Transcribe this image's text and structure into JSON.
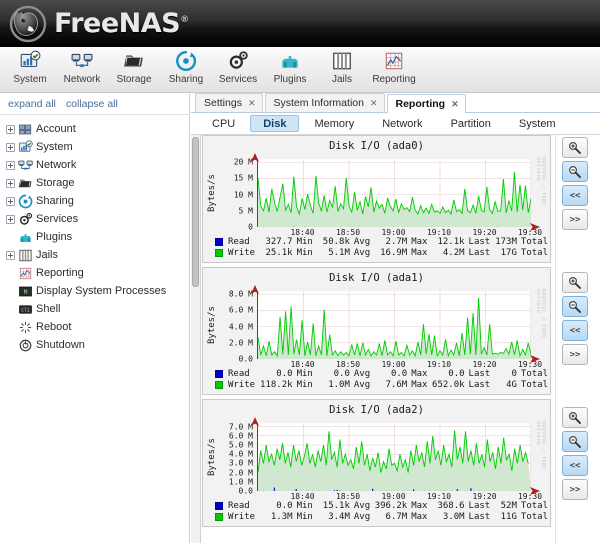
{
  "brand": {
    "name": "FreeNAS",
    "registered": "®",
    "logo_icon": "freenas-mascot-logo"
  },
  "toolbar": {
    "items": [
      {
        "label": "System",
        "icon": "system-icon"
      },
      {
        "label": "Network",
        "icon": "network-icon"
      },
      {
        "label": "Storage",
        "icon": "storage-icon"
      },
      {
        "label": "Sharing",
        "icon": "sharing-icon"
      },
      {
        "label": "Services",
        "icon": "services-gear-icon"
      },
      {
        "label": "Plugins",
        "icon": "plugins-icon"
      },
      {
        "label": "Jails",
        "icon": "jails-icon"
      },
      {
        "label": "Reporting",
        "icon": "reporting-icon"
      }
    ]
  },
  "sidebar": {
    "expand_all": "expand all",
    "collapse_all": "collapse all",
    "items": [
      {
        "label": "Account",
        "icon": "account-icon",
        "expandable": true
      },
      {
        "label": "System",
        "icon": "system-icon",
        "expandable": true
      },
      {
        "label": "Network",
        "icon": "network-icon",
        "expandable": true
      },
      {
        "label": "Storage",
        "icon": "storage-icon",
        "expandable": true
      },
      {
        "label": "Sharing",
        "icon": "sharing-icon",
        "expandable": true
      },
      {
        "label": "Services",
        "icon": "services-gear-icon",
        "expandable": true
      },
      {
        "label": "Plugins",
        "icon": "plugins-icon",
        "expandable": false
      },
      {
        "label": "Jails",
        "icon": "jails-icon",
        "expandable": true
      },
      {
        "label": "Reporting",
        "icon": "reporting-icon",
        "expandable": false
      },
      {
        "label": "Display System Processes",
        "icon": "processes-icon",
        "expandable": false
      },
      {
        "label": "Shell",
        "icon": "shell-icon",
        "expandable": false
      },
      {
        "label": "Reboot",
        "icon": "reboot-icon",
        "expandable": false
      },
      {
        "label": "Shutdown",
        "icon": "shutdown-icon",
        "expandable": false
      }
    ]
  },
  "tabs": [
    {
      "label": "Settings",
      "active": false,
      "close": "✕"
    },
    {
      "label": "System Information",
      "active": false,
      "close": "✕"
    },
    {
      "label": "Reporting",
      "active": true,
      "close": "✕"
    }
  ],
  "subtabs": [
    {
      "label": "CPU",
      "active": false
    },
    {
      "label": "Disk",
      "active": true
    },
    {
      "label": "Memory",
      "active": false
    },
    {
      "label": "Network",
      "active": false
    },
    {
      "label": "Partition",
      "active": false
    },
    {
      "label": "System",
      "active": false
    }
  ],
  "rail_buttons": [
    {
      "name": "zoom-in-button",
      "label": "↖",
      "selected": false
    },
    {
      "name": "zoom-out-button",
      "label": "↘",
      "selected": true
    },
    {
      "name": "back-button",
      "label": "<<",
      "selected": true
    },
    {
      "name": "forward-button",
      "label": ">>",
      "selected": false
    }
  ],
  "colors": {
    "read": "#0000cc",
    "write": "#00cc00",
    "write_fill": "#cfe8cf",
    "axis": "#b02020",
    "grid": "#e8cfcf",
    "accent_blue": "#cfe4f5"
  },
  "watermark": "RRDTOOL / TOBI OETIKER",
  "chart_data": [
    {
      "type": "area",
      "title": "Disk I/O (ada0)",
      "ylabel": "Bytes/s",
      "xlabel": "",
      "grid": true,
      "legend_position": "bottom",
      "ylim": [
        0,
        21000000
      ],
      "yticks": [
        {
          "value": 0,
          "label": "0"
        },
        {
          "value": 5000000,
          "label": "5 M"
        },
        {
          "value": 10000000,
          "label": "10 M"
        },
        {
          "value": 15000000,
          "label": "15 M"
        },
        {
          "value": 20000000,
          "label": "20 M"
        }
      ],
      "xticks": [
        "18:40",
        "18:50",
        "19:00",
        "19:10",
        "19:20",
        "19:30"
      ],
      "xlim": [
        "18:33",
        "19:33"
      ],
      "series": [
        {
          "name": "Read",
          "color": "#0000cc",
          "min": "327.7",
          "avg": "50.8k",
          "max": "2.7M",
          "last": "12.1k",
          "total": "173M",
          "values": [
            0.02,
            0.01,
            0.03,
            0.01,
            0.02,
            0.01,
            0.05,
            0.02,
            0.01,
            0.03,
            0.01,
            0.02,
            0.01,
            0.12,
            0.01,
            0.02,
            0.01,
            0.03,
            0.01,
            0.02,
            0.01,
            0.02,
            0.01,
            0.02,
            0.01,
            0.03,
            0.01,
            0.02,
            0.01,
            0.02,
            0.01,
            0.02,
            0.01,
            0.03,
            0.01,
            0.02,
            0.01,
            0.02,
            0.01,
            0.03,
            0.01,
            0.02,
            0.01,
            0.02,
            0.01,
            0.03,
            0.01,
            0.02,
            0.01,
            0.04,
            0.01,
            0.02,
            0.01,
            0.02,
            0.01,
            0.03,
            0.01,
            0.02,
            0.01,
            0.02,
            0.01,
            0.03,
            0.01,
            0.02,
            0.01,
            0.02,
            0.01,
            0.02,
            0.01,
            0.03,
            0.01,
            0.02,
            0.01,
            0.02,
            0.01,
            0.03,
            0.01,
            0.02,
            0.01,
            0.02,
            0.01,
            0.02,
            0.01,
            0.03,
            0.01,
            0.02,
            0.01,
            0.08,
            0.01,
            0.02,
            0.01,
            0.03,
            0.01,
            0.02,
            0.01,
            0.02,
            0.01,
            0.02,
            0.01,
            0.01
          ]
        },
        {
          "name": "Write",
          "color": "#00cc00",
          "min": "25.1k",
          "avg": "5.1M",
          "max": "16.9M",
          "last": "4.2M",
          "total": "17G",
          "values": [
            15.2,
            6.4,
            5.0,
            8.9,
            4.6,
            11.8,
            7.6,
            4.8,
            9.2,
            13.4,
            5.2,
            7.0,
            4.4,
            15.6,
            6.2,
            4.0,
            8.8,
            5.4,
            10.2,
            6.6,
            4.2,
            15.8,
            7.4,
            5.0,
            9.8,
            4.6,
            8.2,
            6.0,
            12.6,
            4.8,
            7.2,
            5.6,
            15.2,
            6.8,
            4.4,
            10.8,
            5.2,
            7.8,
            4.0,
            9.4,
            6.2,
            12.2,
            4.6,
            8.0,
            5.8,
            7.0,
            4.2,
            9.0,
            6.4,
            5.0,
            8.6,
            4.4,
            7.2,
            5.4,
            6.0,
            4.8,
            9.2,
            5.2,
            4.0,
            6.6,
            4.4,
            5.8,
            4.2,
            7.0,
            4.6,
            5.0,
            4.2,
            6.2,
            4.4,
            5.2,
            4.0,
            8.4,
            4.8,
            5.4,
            4.2,
            11.8,
            5.0,
            4.4,
            6.8,
            4.2,
            9.6,
            5.2,
            4.6,
            12.4,
            5.4,
            4.2,
            7.8,
            4.8,
            5.0,
            14.8,
            4.4,
            8.2,
            5.0,
            17.0,
            4.6,
            13.0,
            5.2,
            12.8,
            4.4,
            8.8
          ]
        }
      ]
    },
    {
      "type": "area",
      "title": "Disk I/O (ada1)",
      "ylabel": "Bytes/s",
      "xlabel": "",
      "grid": true,
      "legend_position": "bottom",
      "ylim": [
        0,
        8400000
      ],
      "yticks": [
        {
          "value": 0,
          "label": "0.0"
        },
        {
          "value": 2000000,
          "label": "2.0 M"
        },
        {
          "value": 4000000,
          "label": "4.0 M"
        },
        {
          "value": 6000000,
          "label": "6.0 M"
        },
        {
          "value": 8000000,
          "label": "8.0 M"
        }
      ],
      "xticks": [
        "18:40",
        "18:50",
        "19:00",
        "19:10",
        "19:20",
        "19:30"
      ],
      "xlim": [
        "18:33",
        "19:33"
      ],
      "series": [
        {
          "name": "Read",
          "color": "#0000cc",
          "min": "0.0",
          "avg": "0.0",
          "max": "0.0",
          "last": "0.0",
          "total": "0",
          "values": [
            0,
            0,
            0,
            0,
            0,
            0,
            0,
            0,
            0,
            0,
            0,
            0,
            0,
            0,
            0,
            0,
            0,
            0,
            0,
            0,
            0,
            0,
            0,
            0,
            0,
            0,
            0,
            0,
            0,
            0,
            0,
            0,
            0,
            0,
            0,
            0,
            0,
            0,
            0,
            0,
            0,
            0,
            0,
            0,
            0,
            0,
            0,
            0,
            0,
            0,
            0,
            0,
            0,
            0,
            0,
            0,
            0,
            0,
            0,
            0,
            0,
            0,
            0,
            0,
            0,
            0,
            0,
            0,
            0,
            0,
            0,
            0,
            0,
            0,
            0,
            0,
            0,
            0,
            0,
            0,
            0,
            0,
            0,
            0,
            0,
            0,
            0,
            0,
            0,
            0,
            0,
            0,
            0,
            0,
            0,
            0,
            0,
            0,
            0,
            0
          ]
        },
        {
          "name": "Write",
          "color": "#00cc00",
          "min": "118.2k",
          "avg": "1.0M",
          "max": "7.6M",
          "last": "652.0k",
          "total": "4G",
          "values": [
            2.7,
            0.5,
            1.6,
            0.4,
            2.2,
            0.5,
            0.9,
            0.4,
            5.2,
            0.6,
            5.9,
            0.5,
            6.5,
            0.6,
            2.4,
            0.5,
            4.8,
            0.4,
            2.1,
            0.5,
            4.4,
            0.4,
            1.6,
            0.5,
            6.1,
            0.4,
            3.0,
            0.5,
            1.0,
            0.4,
            0.9,
            0.5,
            0.8,
            0.4,
            1.8,
            0.5,
            1.9,
            0.4,
            2.0,
            0.5,
            1.2,
            0.4,
            0.9,
            0.5,
            1.9,
            0.4,
            2.3,
            0.5,
            0.9,
            0.4,
            2.2,
            0.5,
            0.8,
            0.4,
            1.7,
            0.5,
            1.0,
            0.4,
            2.1,
            0.5,
            4.3,
            0.6,
            3.1,
            0.5,
            2.9,
            0.4,
            1.0,
            0.5,
            2.4,
            0.4,
            1.1,
            0.5,
            2.0,
            0.4,
            3.2,
            0.5,
            5.1,
            0.6,
            5.7,
            0.5,
            7.6,
            0.6,
            1.4,
            0.5,
            4.3,
            0.6,
            0.7,
            0.6,
            0.8,
            0.7,
            1.3,
            0.6,
            2.1,
            0.5,
            2.3,
            0.4,
            1.2,
            0.5,
            2.0,
            0.6,
            1.8,
            1.0
          ]
        }
      ]
    },
    {
      "type": "area",
      "title": "Disk I/O (ada2)",
      "ylabel": "Bytes/s",
      "xlabel": "",
      "grid": true,
      "legend_position": "bottom",
      "ylim": [
        0,
        7400000
      ],
      "yticks": [
        {
          "value": 0,
          "label": "0.0"
        },
        {
          "value": 1000000,
          "label": "1.0 M"
        },
        {
          "value": 2000000,
          "label": "2.0 M"
        },
        {
          "value": 3000000,
          "label": "3.0 M"
        },
        {
          "value": 4000000,
          "label": "4.0 M"
        },
        {
          "value": 5000000,
          "label": "5.0 M"
        },
        {
          "value": 6000000,
          "label": "6.0 M"
        },
        {
          "value": 7000000,
          "label": "7.0 M"
        }
      ],
      "xticks": [
        "18:40",
        "18:50",
        "19:00",
        "19:10",
        "19:20",
        "19:30"
      ],
      "xlim": [
        "18:33",
        "19:33"
      ],
      "series": [
        {
          "name": "Read",
          "color": "#0000cc",
          "min": "0.0",
          "avg": "15.1k",
          "max": "396.2k",
          "last": "368.6",
          "total": "52M",
          "values": [
            0.02,
            0,
            0.01,
            0,
            0.02,
            0,
            0.38,
            0.02,
            0,
            0.01,
            0,
            0.02,
            0,
            0.01,
            0.22,
            0,
            0.01,
            0,
            0.02,
            0,
            0.01,
            0,
            0.02,
            0,
            0.01,
            0,
            0.02,
            0,
            0.08,
            0.12,
            0.05,
            0,
            0.02,
            0,
            0.01,
            0,
            0.02,
            0,
            0.01,
            0,
            0.02,
            0,
            0.25,
            0.01,
            0,
            0.02,
            0,
            0.01,
            0,
            0.02,
            0,
            0.01,
            0,
            0.02,
            0,
            0.01,
            0,
            0.18,
            0,
            0.02,
            0,
            0.01,
            0,
            0.02,
            0,
            0.01,
            0,
            0.02,
            0,
            0.01,
            0,
            0.02,
            0,
            0.22,
            0.01,
            0,
            0.02,
            0,
            0.3,
            0.01,
            0,
            0.02,
            0,
            0.01,
            0,
            0.02,
            0,
            0.01,
            0,
            0.02,
            0,
            0.01,
            0,
            0.02,
            0,
            0.01,
            0,
            0.02,
            0,
            0.01,
            0
          ]
        },
        {
          "name": "Write",
          "color": "#00cc00",
          "min": "1.3M",
          "avg": "3.4M",
          "max": "6.7M",
          "last": "3.0M",
          "total": "11G",
          "values": [
            2.0,
            4.4,
            3.0,
            5.0,
            3.2,
            4.0,
            2.8,
            4.6,
            3.4,
            5.2,
            3.0,
            4.2,
            2.6,
            5.0,
            3.2,
            4.4,
            2.8,
            3.8,
            5.2,
            3.0,
            4.0,
            2.6,
            4.4,
            3.2,
            5.0,
            2.8,
            6.5,
            3.4,
            4.2,
            2.6,
            5.6,
            3.0,
            4.0,
            2.8,
            3.4,
            2.4,
            4.8,
            3.0,
            5.4,
            2.8,
            4.0,
            2.2,
            3.6,
            2.6,
            4.2,
            2.0,
            3.2,
            2.4,
            4.6,
            2.8,
            3.0,
            2.2,
            4.0,
            2.6,
            3.4,
            2.0,
            4.4,
            2.8,
            5.0,
            3.2,
            4.2,
            2.6,
            5.4,
            3.0,
            6.0,
            3.4,
            4.4,
            2.8,
            5.0,
            3.2,
            4.0,
            2.6,
            6.6,
            3.4,
            4.8,
            3.0,
            6.5,
            3.2,
            4.4,
            2.8,
            5.2,
            3.0,
            4.0,
            2.6,
            5.6,
            3.2,
            4.2,
            2.4,
            4.8,
            3.0,
            5.8,
            3.4,
            4.0,
            2.2,
            4.6,
            3.0,
            5.0,
            3.2,
            4.2,
            3.0
          ]
        }
      ]
    }
  ],
  "legend_labels": {
    "min": "Min",
    "avg": "Avg",
    "max": "Max",
    "last": "Last",
    "total": "Total"
  }
}
